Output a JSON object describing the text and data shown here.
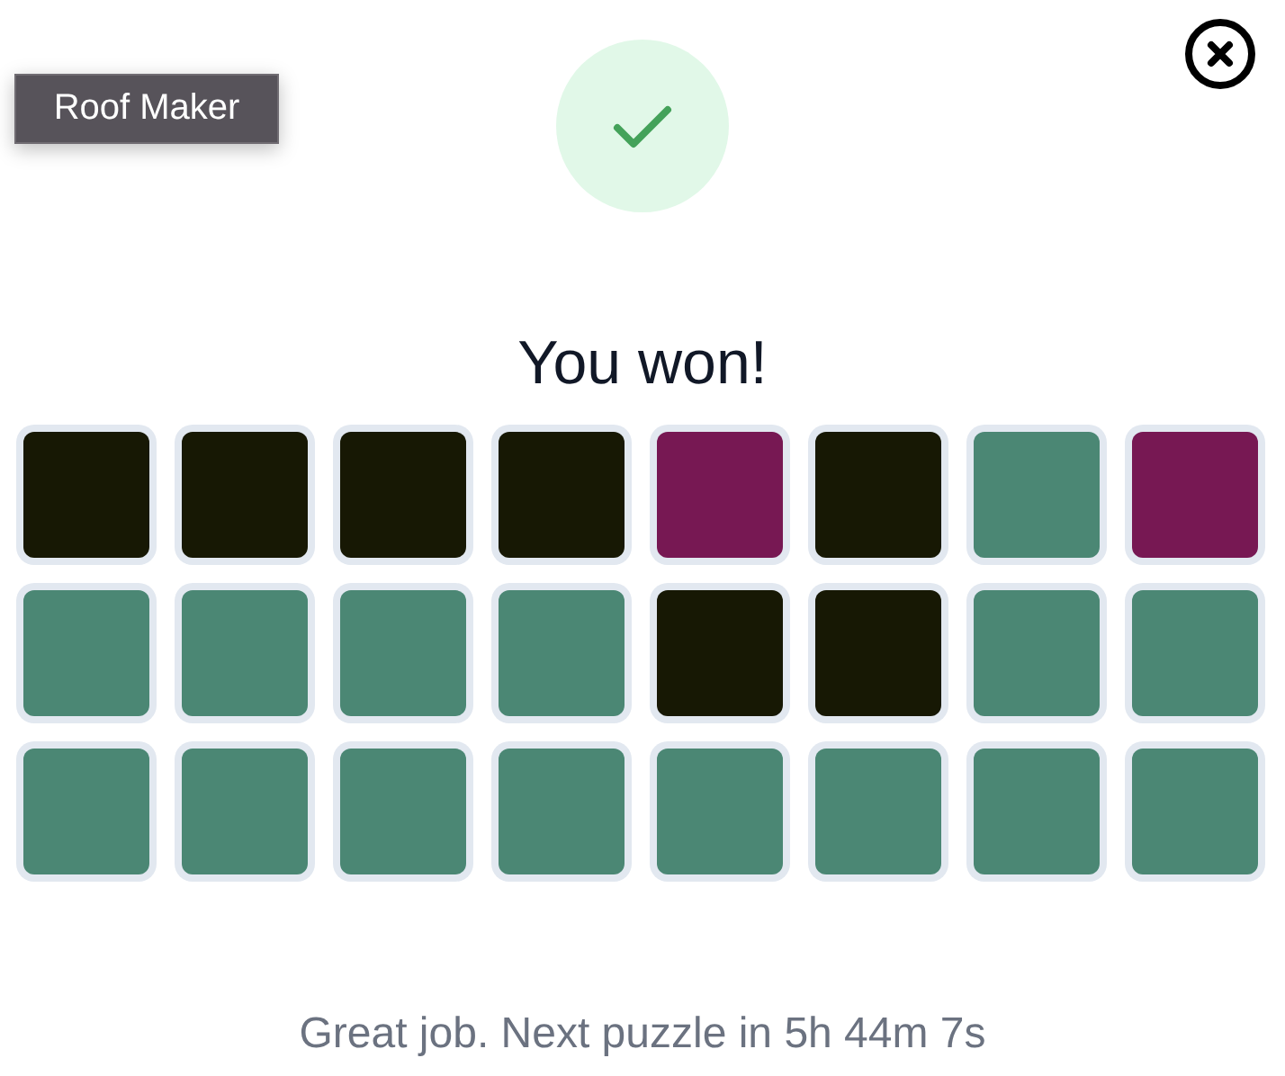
{
  "tooltip": {
    "text": "Roof Maker"
  },
  "title": "You won!",
  "tiles": [
    [
      {
        "color": "#171804"
      },
      {
        "color": "#171804"
      },
      {
        "color": "#171804"
      },
      {
        "color": "#171804"
      },
      {
        "color": "#771853"
      },
      {
        "color": "#171804"
      },
      {
        "color": "#4b8774"
      },
      {
        "color": "#771853"
      }
    ],
    [
      {
        "color": "#4b8774"
      },
      {
        "color": "#4b8774"
      },
      {
        "color": "#4b8774"
      },
      {
        "color": "#4b8774"
      },
      {
        "color": "#171804"
      },
      {
        "color": "#171804"
      },
      {
        "color": "#4b8774"
      },
      {
        "color": "#4b8774"
      }
    ],
    [
      {
        "color": "#4b8774"
      },
      {
        "color": "#4b8774"
      },
      {
        "color": "#4b8774"
      },
      {
        "color": "#4b8774"
      },
      {
        "color": "#4b8774"
      },
      {
        "color": "#4b8774"
      },
      {
        "color": "#4b8774"
      },
      {
        "color": "#4b8774"
      }
    ]
  ],
  "message": "Great job. Next puzzle in 5h 44m 7s"
}
